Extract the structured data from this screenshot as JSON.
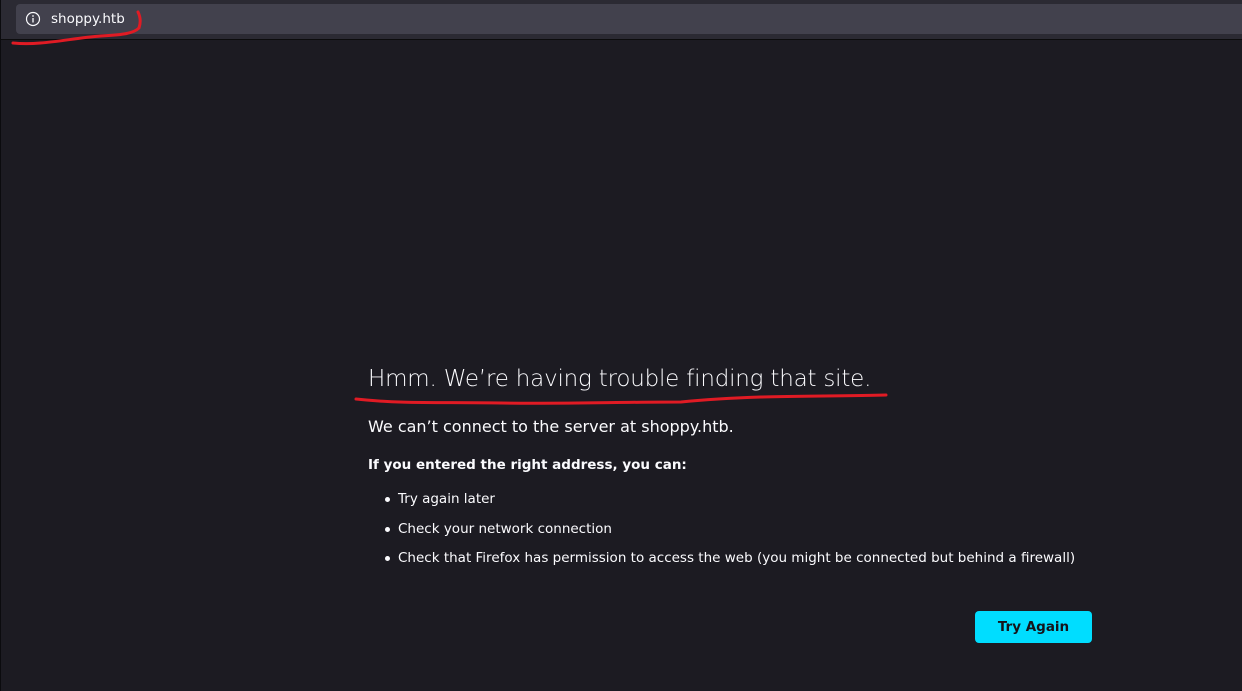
{
  "browser": {
    "url": "shoppy.htb",
    "site_info_icon": "info-circle-icon"
  },
  "error_page": {
    "title": "Hmm. We’re having trouble finding that site.",
    "lead": "We can’t connect to the server at shoppy.htb.",
    "subhead": "If you entered the right address, you can:",
    "suggestions": [
      "Try again later",
      "Check your network connection",
      "Check that Firefox has permission to access the web (you might be connected but behind a firewall)"
    ],
    "try_again_label": "Try Again"
  },
  "colors": {
    "background": "#1c1b22",
    "toolbar": "#2b2a33",
    "urlbar": "#42414d",
    "text": "#fbfbfe",
    "accent_button": "#00ddff",
    "annotation": "#e01b24"
  }
}
